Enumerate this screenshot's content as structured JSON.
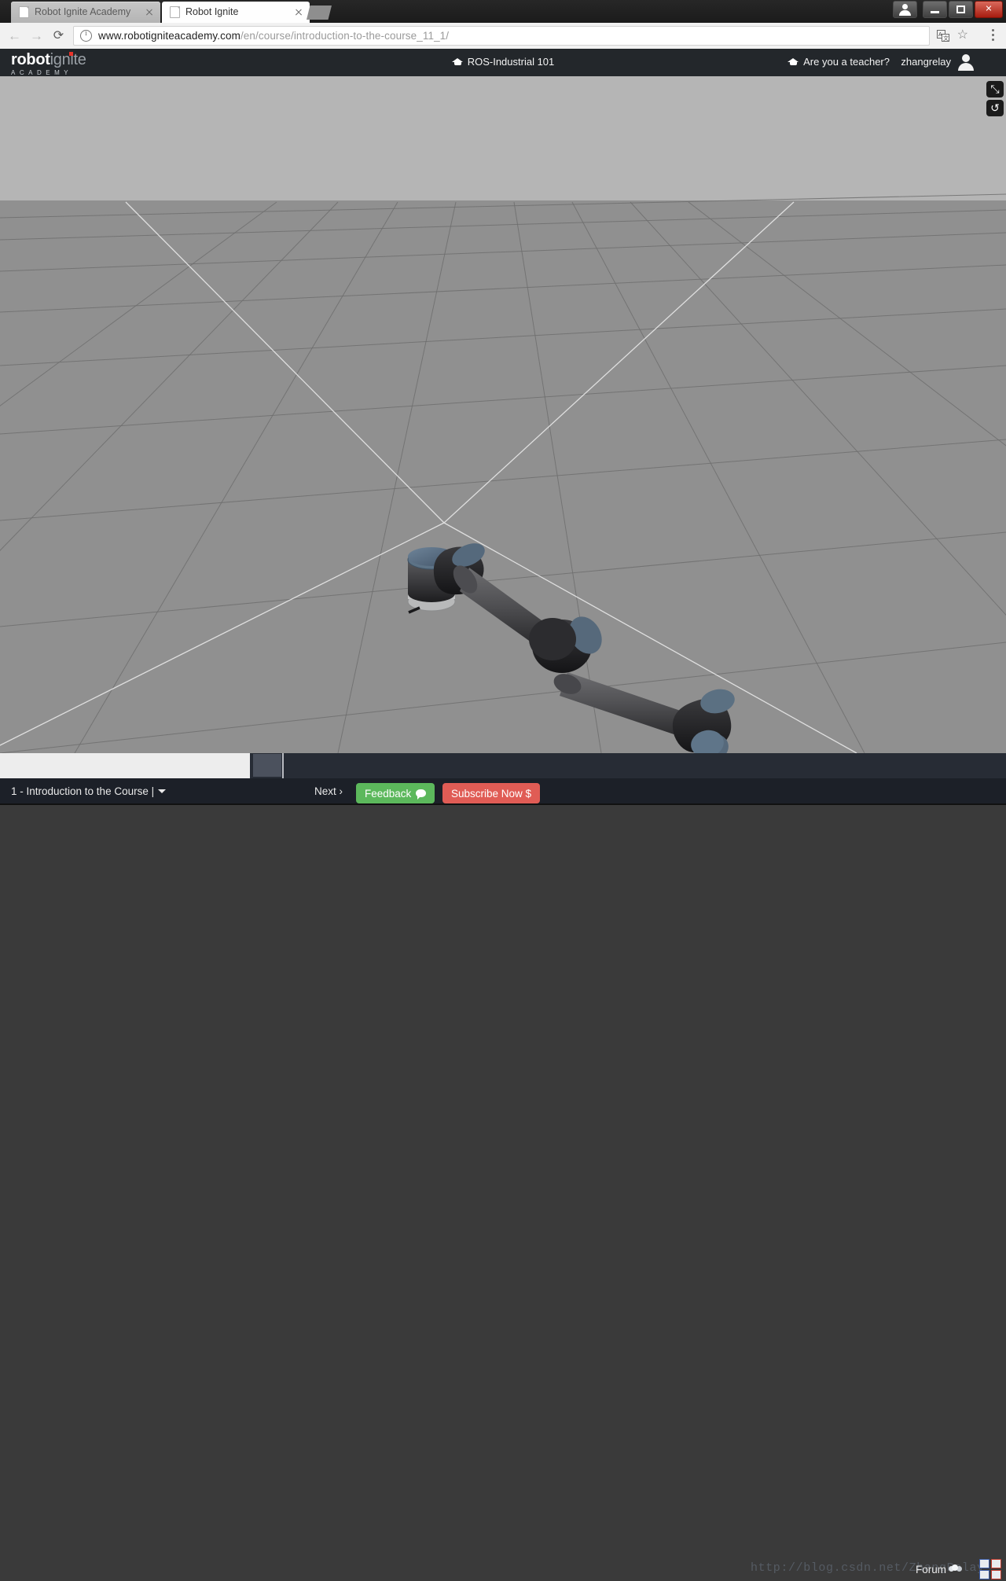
{
  "browser": {
    "tabs": [
      {
        "title": "Robot Ignite Academy",
        "active": false
      },
      {
        "title": "Robot Ignite",
        "active": true
      }
    ],
    "new_tab_label": "+",
    "nav": {
      "back": "←",
      "forward": "→",
      "reload": "⟳"
    },
    "url_secure_part": "www.robotigniteacademy.com",
    "url_path_part": "/en/course/introduction-to-the-course_11_1/",
    "window_controls": {
      "account": "account",
      "minimize": "minimize",
      "restore": "restore",
      "close": "✕"
    }
  },
  "site_header": {
    "logo_main_bold": "robot",
    "logo_main_light": "ignite",
    "logo_sub": "ACADEMY",
    "course_title": "ROS-Industrial 101",
    "teacher_link": "Are you a teacher?",
    "username": "zhangrelay"
  },
  "viewport": {
    "sim_name": "gazebo-simulation",
    "sky_color": "#b5b5b5",
    "ground_color": "#909090",
    "grid_line_color": "#6f6f6f",
    "axis_line_color": "#e8e8e8",
    "robot": {
      "model": "Universal Robots UR arm",
      "link_color": "#3a3a3c",
      "joint_color": "#5d7386",
      "base_color": "#b8b9ba"
    },
    "buttons": {
      "expand": "⤡",
      "reset": "↺"
    }
  },
  "bottom_bar": {
    "lesson_label": "1 - Introduction to the Course |",
    "next_label": "Next ›",
    "feedback_label": "Feedback",
    "subscribe_label": "Subscribe Now $",
    "forum_label": "Forum",
    "watermark": "http://blog.csdn.net/ZhangRelay"
  }
}
